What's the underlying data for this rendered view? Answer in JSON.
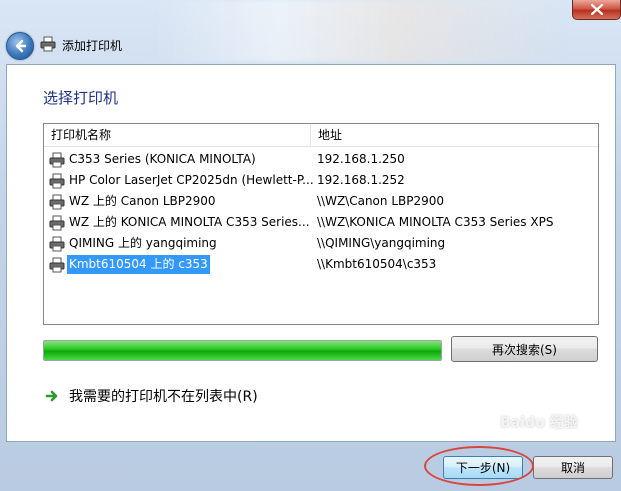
{
  "window": {
    "title": "添加打印机",
    "close_glyph": "✕"
  },
  "main": {
    "heading": "选择打印机",
    "table": {
      "columns": [
        "打印机名称",
        "地址"
      ],
      "rows": [
        {
          "name": "C353 Series (KONICA MINOLTA)",
          "address": "192.168.1.250",
          "selected": false
        },
        {
          "name": "HP Color LaserJet CP2025dn (Hewlett-P...",
          "address": "192.168.1.252",
          "selected": false
        },
        {
          "name": "WZ 上的 Canon LBP2900",
          "address": "\\\\WZ\\Canon LBP2900",
          "selected": false
        },
        {
          "name": "WZ 上的 KONICA MINOLTA C353 Series...",
          "address": "\\\\WZ\\KONICA MINOLTA C353 Series XPS",
          "selected": false
        },
        {
          "name": "QIMING 上的 yangqiming",
          "address": "\\\\QIMING\\yangqiming",
          "selected": false
        },
        {
          "name": "Kmbt610504 上的 c353",
          "address": "\\\\Kmbt610504\\c353",
          "selected": true
        }
      ]
    },
    "progress": {
      "value": 1.0
    },
    "search_again_label": "再次搜索(S)",
    "missing_printer_label": "我需要的打印机不在列表中(R)"
  },
  "footer": {
    "next_label": "下一步(N)",
    "cancel_label": "取消"
  },
  "watermark": "Baidu 经验",
  "icons": {
    "back": "back-arrow-icon",
    "title": "printer-icon",
    "row": "printer-icon",
    "missing": "green-arrow-icon"
  },
  "colors": {
    "heading": "#1e3287",
    "selection": "#3399ff",
    "progress": "#2fcb28",
    "annotation": "#d5483d"
  }
}
